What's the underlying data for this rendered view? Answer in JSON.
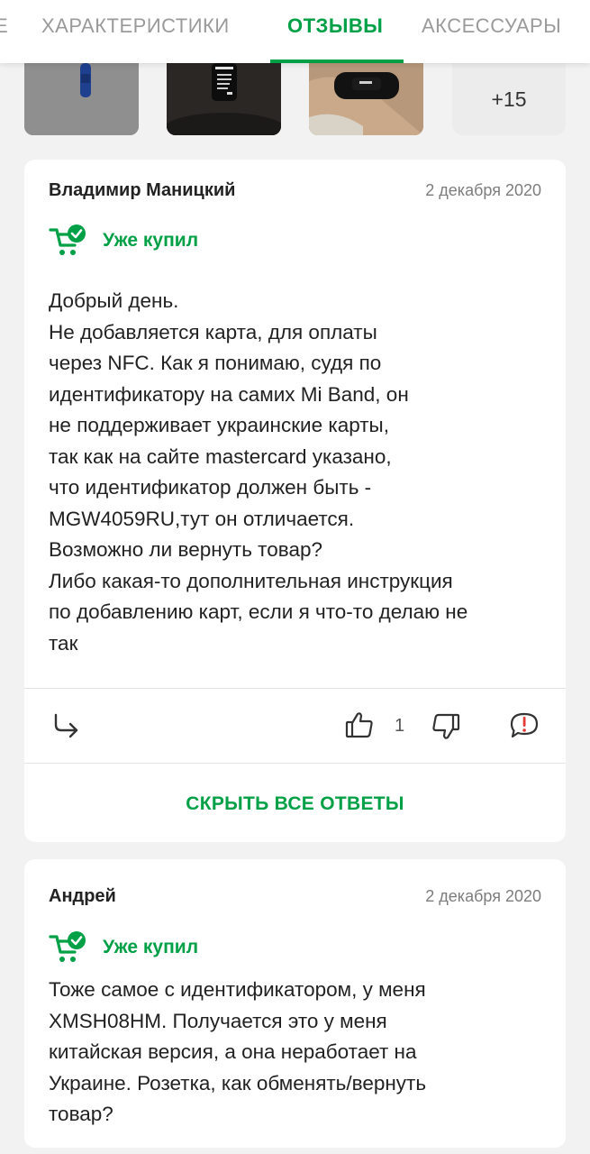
{
  "tabs": [
    {
      "label": "Е"
    },
    {
      "label": "ХАРАКТЕРИСТИКИ"
    },
    {
      "label": "ОТЗЫВЫ"
    },
    {
      "label": "АКСЕССУАРЫ"
    }
  ],
  "active_tab": "ОТЗЫВЫ",
  "photos": {
    "more_label": "+15"
  },
  "reviews": [
    {
      "author": "Владимир Маницкий",
      "date": "2 декабря 2020",
      "bought_label": "Уже купил",
      "text": "Добрый день.\nНе добавляется карта, для оплаты\nчерез NFC. Как я понимаю, судя по\nидентификатору на самих Mi Band, он\nне поддерживает украинские карты,\nтак как на сайте mastercard указано,\nчто идентификатор должен быть -\nMGW4059RU,тут он отличается.\nВозможно ли вернуть товар?\nЛибо какая-то дополнительная инструкция\nпо добавлению карт, если я что-то делаю не\nтак",
      "likes": "1",
      "hide_answers_label": "СКРЫТЬ ВСЕ ОТВЕТЫ"
    },
    {
      "author": "Андрей",
      "date": "2 декабря 2020",
      "bought_label": "Уже купил",
      "text": "Тоже самое с идентификатором, у меня\nXMSH08HM. Получается это у меня\nкитайская версия, а она неработает на\nУкраине. Розетка, как обменять/вернуть\nтовар?"
    }
  ],
  "colors": {
    "accent": "#00a046",
    "text": "#222222",
    "muted": "#7d7d7d",
    "background": "#f2f2f2"
  },
  "icons": {
    "bought": "cart-check-icon",
    "reply": "reply-arrow-icon",
    "like": "thumbs-up-icon",
    "dislike": "thumbs-down-icon",
    "report": "report-bubble-icon"
  }
}
